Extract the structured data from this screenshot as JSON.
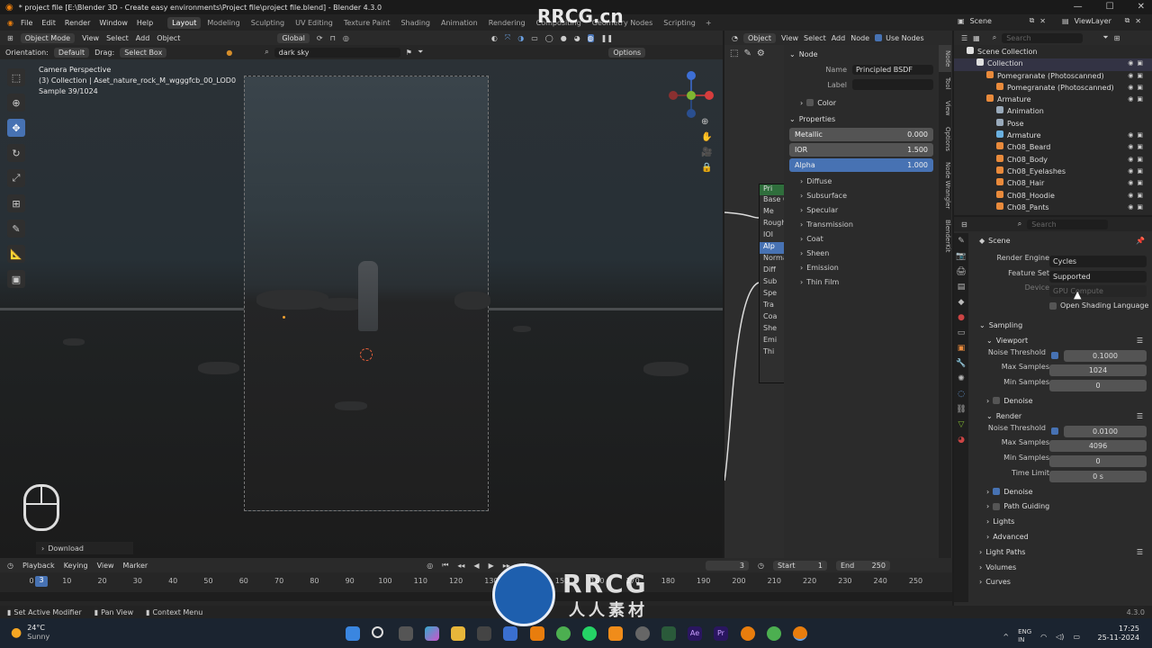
{
  "titlebar": {
    "title": "* project file [E:\\Blender 3D - Create easy environments\\Project file\\project file.blend] - Blender 4.3.0"
  },
  "menubar": {
    "menus": [
      "File",
      "Edit",
      "Render",
      "Window",
      "Help"
    ],
    "workspaces": [
      "Layout",
      "Modeling",
      "Sculpting",
      "UV Editing",
      "Texture Paint",
      "Shading",
      "Animation",
      "Rendering",
      "Compositing",
      "Geometry Nodes",
      "Scripting"
    ],
    "active_workspace": "Layout",
    "scene": "Scene",
    "view_layer": "ViewLayer"
  },
  "viewport_header": {
    "mode": "Object Mode",
    "menus": [
      "View",
      "Select",
      "Add",
      "Object"
    ],
    "transform": "Global",
    "orientation_label": "Orientation:",
    "orientation_value": "Default",
    "drag_label": "Drag:",
    "drag_value": "Select Box",
    "search_value": "dark sky",
    "options": "Options"
  },
  "viewport": {
    "info_line1": "Camera Perspective",
    "info_line2": "(3) Collection | Aset_nature_rock_M_wgggfcb_00_LOD0",
    "info_line3": "Sample 39/1024",
    "download_label": "Download"
  },
  "node_editor": {
    "header_type": "Object",
    "menus": [
      "View",
      "Select",
      "Add",
      "Node"
    ],
    "use_nodes": "Use Nodes",
    "node_title": "Pri",
    "node_sockets": [
      "Base C",
      "Me",
      "Rough",
      "IOI",
      "Alp",
      "Norma",
      "Diff",
      "Sub",
      "Spe",
      "Tra",
      "Coa",
      "She",
      "Emi",
      "Thi"
    ]
  },
  "npanel": {
    "node_section": "Node",
    "name_label": "Name",
    "name_value": "Principled BSDF",
    "label_label": "Label",
    "label_value": "",
    "color_section": "Color",
    "properties_section": "Properties",
    "sliders": [
      {
        "label": "Metallic",
        "value": "0.000",
        "active": false
      },
      {
        "label": "IOR",
        "value": "1.500",
        "active": false
      },
      {
        "label": "Alpha",
        "value": "1.000",
        "active": true
      }
    ],
    "subpanels": [
      "Diffuse",
      "Subsurface",
      "Specular",
      "Transmission",
      "Coat",
      "Sheen",
      "Emission",
      "Thin Film"
    ],
    "side_tabs": [
      "Node",
      "Tool",
      "View",
      "Options",
      "Node Wrangler",
      "BlenderKit"
    ]
  },
  "outliner": {
    "search_placeholder": "Search",
    "rows": [
      {
        "label": "Scene Collection",
        "indent": 0,
        "color": "#e0e0e0"
      },
      {
        "label": "Collection",
        "indent": 1,
        "color": "#e0e0e0"
      },
      {
        "label": "Pomegranate (Photoscanned)",
        "indent": 2,
        "color": "#e98a3b"
      },
      {
        "label": "Pomegranate (Photoscanned)",
        "indent": 3,
        "color": "#e98a3b"
      },
      {
        "label": "Armature",
        "indent": 2,
        "color": "#e98a3b"
      },
      {
        "label": "Animation",
        "indent": 3,
        "color": "#9ab"
      },
      {
        "label": "Pose",
        "indent": 3,
        "color": "#9ab"
      },
      {
        "label": "Armature",
        "indent": 3,
        "color": "#6ab0e0"
      },
      {
        "label": "Ch08_Beard",
        "indent": 3,
        "color": "#e98a3b"
      },
      {
        "label": "Ch08_Body",
        "indent": 3,
        "color": "#e98a3b"
      },
      {
        "label": "Ch08_Eyelashes",
        "indent": 3,
        "color": "#e98a3b"
      },
      {
        "label": "Ch08_Hair",
        "indent": 3,
        "color": "#e98a3b"
      },
      {
        "label": "Ch08_Hoodie",
        "indent": 3,
        "color": "#e98a3b"
      },
      {
        "label": "Ch08_Pants",
        "indent": 3,
        "color": "#e98a3b"
      }
    ]
  },
  "properties": {
    "search_placeholder": "Search",
    "context": "Scene",
    "render_engine_label": "Render Engine",
    "render_engine_value": "Cycles",
    "feature_set_label": "Feature Set",
    "feature_set_value": "Supported",
    "device_label": "Device",
    "device_value": "GPU Compute",
    "open_shading_language": "Open Shading Language",
    "sampling": "Sampling",
    "viewport_sub": "Viewport",
    "vp_noise_label": "Noise Threshold",
    "vp_noise_value": "0.1000",
    "vp_max_label": "Max Samples",
    "vp_max_value": "1024",
    "vp_min_label": "Min Samples",
    "vp_min_value": "0",
    "vp_denoise": "Denoise",
    "render_sub": "Render",
    "r_noise_label": "Noise Threshold",
    "r_noise_value": "0.0100",
    "r_max_label": "Max Samples",
    "r_max_value": "4096",
    "r_min_label": "Min Samples",
    "r_min_value": "0",
    "r_time_label": "Time Limit",
    "r_time_value": "0 s",
    "r_denoise": "Denoise",
    "path_guiding": "Path Guiding",
    "lights": "Lights",
    "advanced": "Advanced",
    "light_paths": "Light Paths",
    "volumes": "Volumes",
    "curves": "Curves"
  },
  "timeline": {
    "menus": [
      "Playback",
      "Keying",
      "View",
      "Marker"
    ],
    "current_frame": "3",
    "start_label": "Start",
    "start_value": "1",
    "end_label": "End",
    "end_value": "250",
    "ruler": [
      "0",
      "10",
      "20",
      "30",
      "40",
      "50",
      "60",
      "70",
      "80",
      "90",
      "100",
      "110",
      "120",
      "130",
      "140",
      "150",
      "160",
      "170",
      "180",
      "190",
      "200",
      "210",
      "220",
      "230",
      "240",
      "250"
    ],
    "playhead": "3"
  },
  "statusbar": {
    "items": [
      "Set Active Modifier",
      "Pan View",
      "Context Menu"
    ],
    "version": "4.3.0"
  },
  "taskbar": {
    "temperature": "24°C",
    "weather": "Sunny",
    "lang1": "ENG",
    "lang2": "IN",
    "time": "17:25",
    "date": "25-11-2024"
  },
  "watermarks": {
    "top": "RRCG.cn",
    "bottom_big": "RRCG",
    "bottom_cn": "人人素材"
  }
}
